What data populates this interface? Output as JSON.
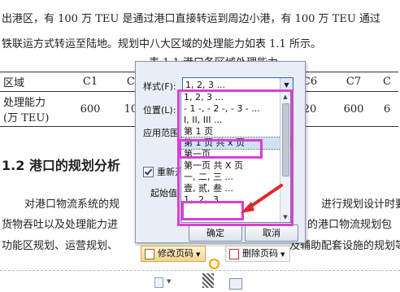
{
  "document": {
    "line1": "出港区，有 100 万 TEU 是通过港口直接转运到周边小港，有 100 万 TEU 通过",
    "line2": "铁联运方式转运至陆地。规划中八大区域的处理能力如表 1.1 所示。",
    "table_caption": "表 1.1 港口各区域处理能力",
    "table": {
      "header": [
        "区域",
        "C1",
        "C2",
        "",
        "",
        "",
        "C6",
        "C7",
        "C"
      ],
      "row": [
        "处理能力\n(万 TEU)",
        "600",
        "100",
        "",
        "",
        "",
        "20",
        "600",
        "6"
      ]
    },
    "heading": "1.2 港口的规划分析",
    "para_line1_left": "对港口物流系统的规",
    "para_line1_right": "进行规划设计时要",
    "para_line2_left": "货物吞吐以及处理能力进",
    "para_line2_right": "的港口物流规划包",
    "para_line3_left": "功能区规划、运营规划、",
    "para_line3_right": "及辅助配套设施的规划等"
  },
  "dialog": {
    "style_label": "样式(F):",
    "style_value": "1, 2, 3 ...",
    "position_label": "位置(L):",
    "apply_label": "应用范围",
    "restart_label": "重新开",
    "restart_checked": true,
    "start_label": "起始值",
    "options": [
      "1, 2, 3 ...",
      "- 1 -, - 2 -, - 3 - ...",
      "I, II, III ...",
      "第 1 页",
      "第 1 页 共 x 页",
      "第一页",
      "第一页 共 X 页",
      "一, 二, 三 ...",
      "壹, 贰, 叁 ...",
      "1，2，3 ..."
    ],
    "selected_option": "第 1 页 共 x 页",
    "ok_label": "确定",
    "cancel_label": "取消"
  },
  "toolbar": {
    "modify_label": "修改页码",
    "delete_label": "删除页码"
  },
  "icons": {
    "dropdown": "chevron-down-icon",
    "checkbox": "checkbox-checked-icon",
    "edit": "edit-page-number-icon",
    "delete": "delete-page-number-icon",
    "anchor": "anchor-circle-icon",
    "move": "move-handle-icon",
    "page": "page-icon"
  },
  "colors": {
    "highlight": "#d83fd8",
    "arrow": "#e0282a",
    "dialog_bg": "#e9eef6",
    "modify_button": "#f5d58f"
  }
}
